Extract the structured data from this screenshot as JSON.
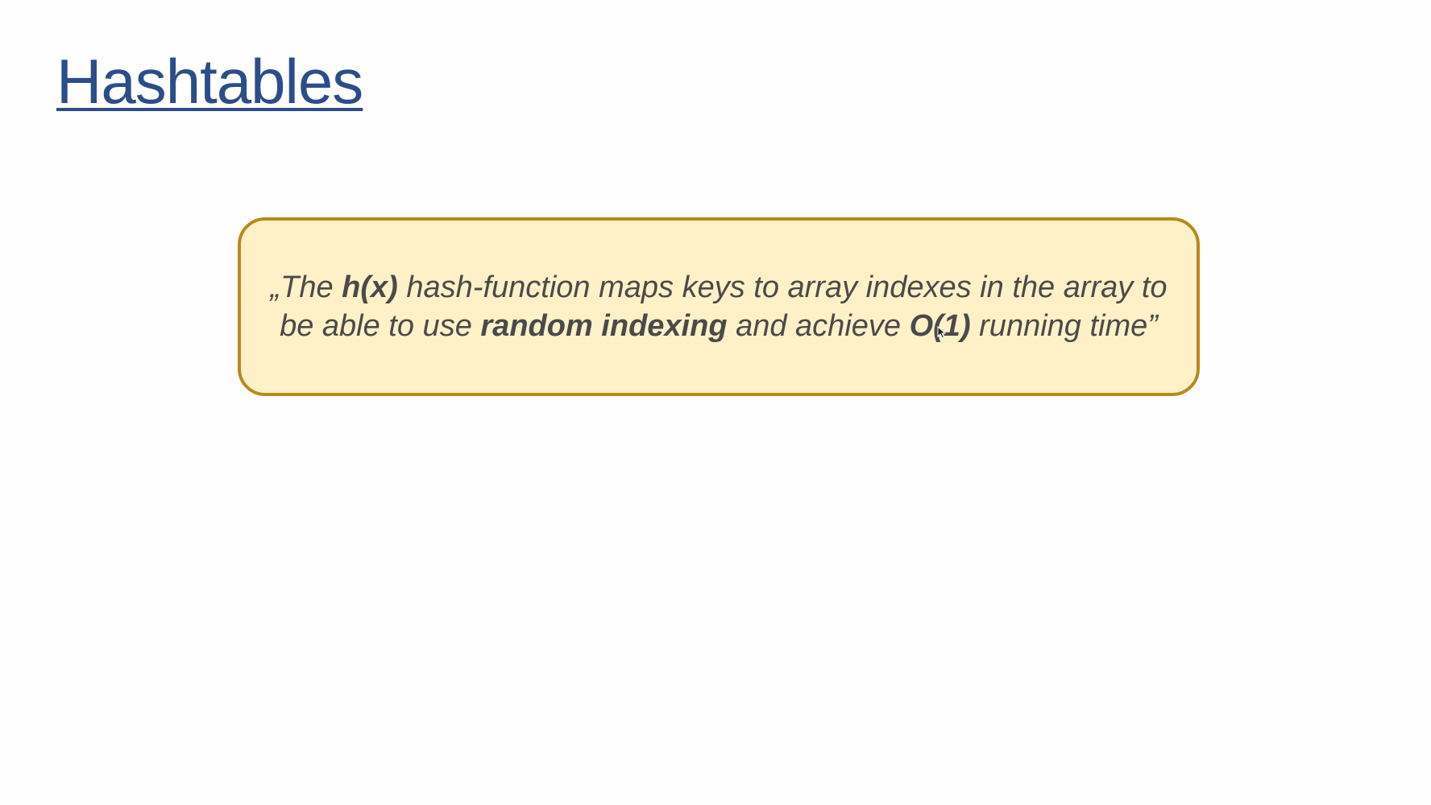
{
  "slide": {
    "title": "Hashtables",
    "quote": {
      "seg1": "„The ",
      "seg2_bold": "h(x)",
      "seg3": " hash-function maps keys to array indexes in the array to be able to use ",
      "seg4_bold": "random indexing",
      "seg5": " and achieve ",
      "seg6_bold": "O(1)",
      "seg7": " running time”"
    }
  },
  "colors": {
    "title": "#2b4d8a",
    "box_fill": "#fef1c8",
    "box_border": "#b98a1a",
    "quote_text": "#4a4a4a"
  },
  "icons": {
    "cursor": "mouse-pointer-icon"
  }
}
